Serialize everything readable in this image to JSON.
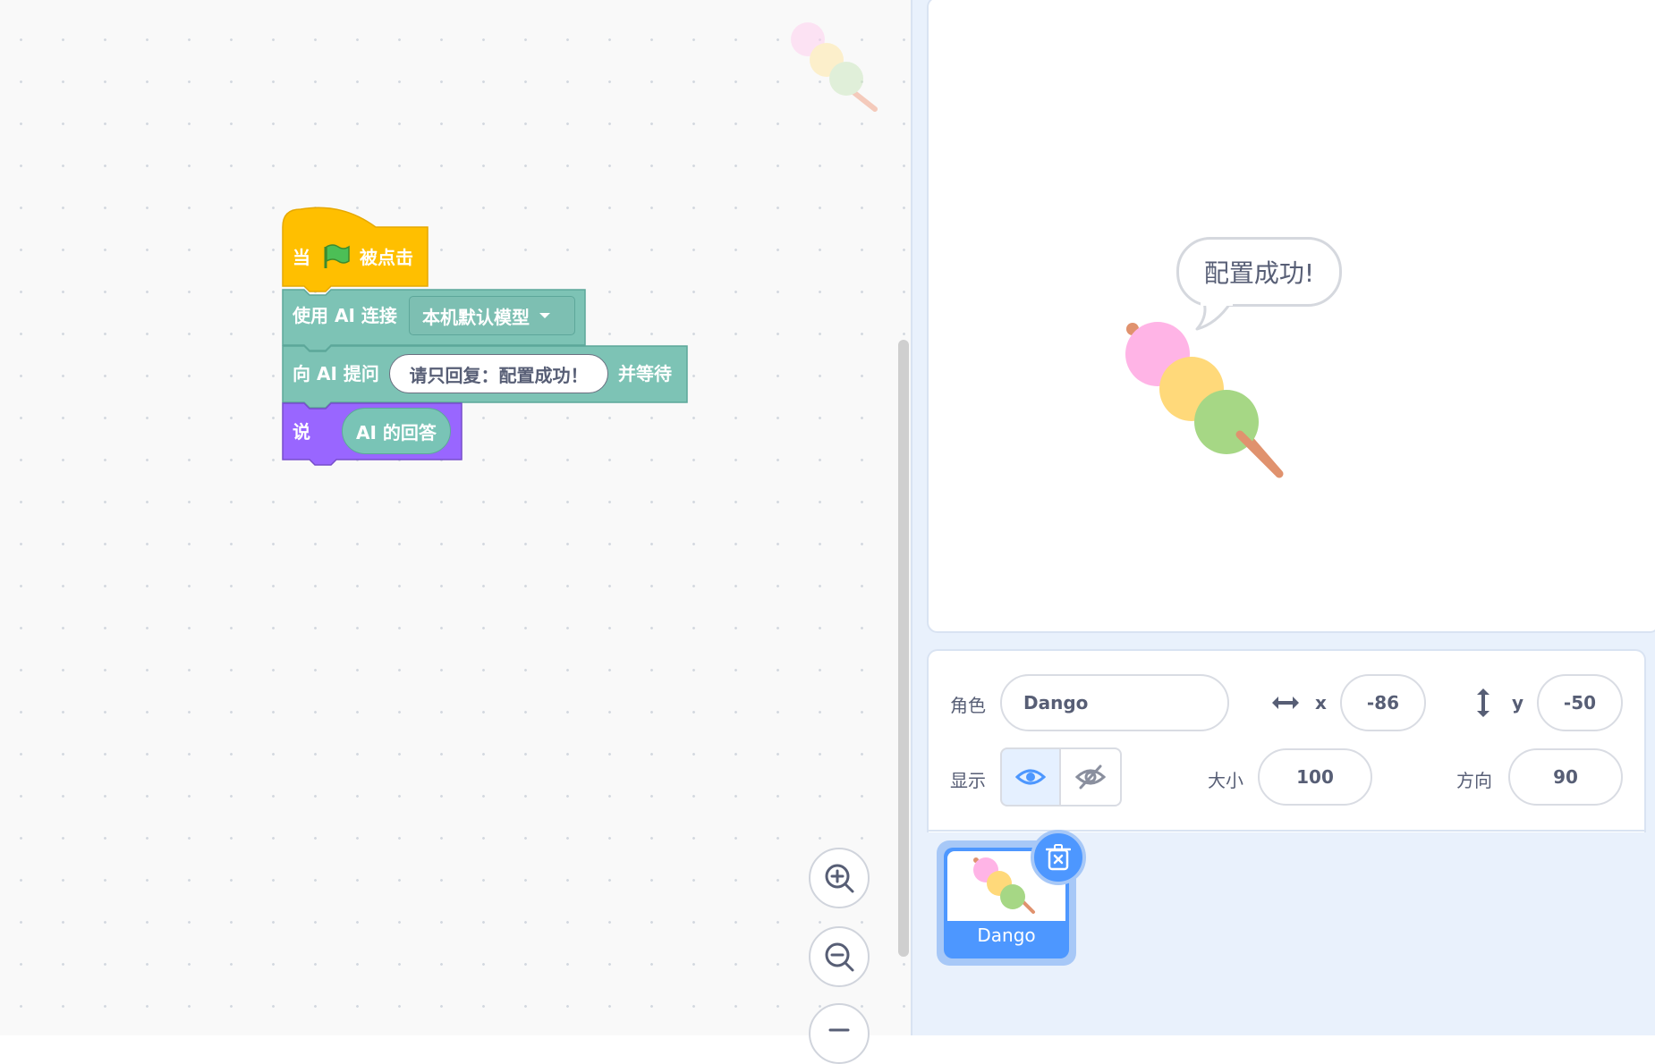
{
  "workspace": {
    "blocks": {
      "hat": {
        "prefix": "当",
        "suffix": "被点击",
        "color": "#ffbf00"
      },
      "connect": {
        "label": "使用 AI 连接",
        "dropdown_value": "本机默认模型",
        "color": "#7dc3b5"
      },
      "ask": {
        "label": "向 AI 提问",
        "input_value": "请只回复：配置成功！",
        "suffix": "并等待",
        "color": "#7dc3b5"
      },
      "say": {
        "label": "说",
        "reporter": "AI 的回答",
        "color": "#9966ff"
      }
    },
    "zoom": {
      "in_icon": "zoom-in-icon",
      "out_icon": "zoom-out-icon",
      "reset_icon": "zoom-reset-icon"
    }
  },
  "stage": {
    "speech_bubble": "配置成功!"
  },
  "sprite_info": {
    "sprite_label": "角色",
    "sprite_name": "Dango",
    "x_label": "x",
    "x_value": "-86",
    "y_label": "y",
    "y_value": "-50",
    "show_label": "显示",
    "size_label": "大小",
    "size_value": "100",
    "direction_label": "方向",
    "direction_value": "90"
  },
  "sprite_list": {
    "items": [
      {
        "name": "Dango",
        "selected": true
      }
    ]
  },
  "colors": {
    "accent": "#4d97ff",
    "event": "#ffbf00",
    "ai_extension": "#7dc3b5",
    "looks": "#9966ff",
    "dango_pink": "#ffb4e6",
    "dango_yellow": "#ffd97a",
    "dango_green": "#a6d785"
  }
}
